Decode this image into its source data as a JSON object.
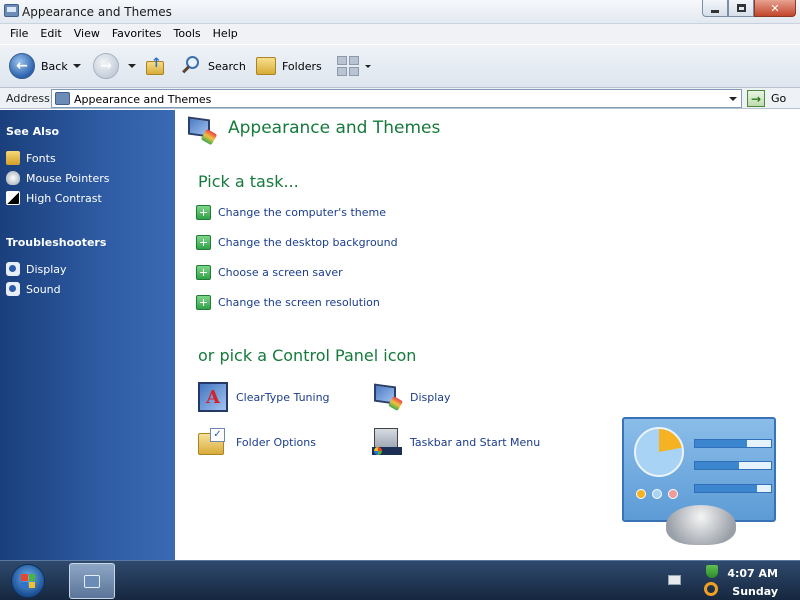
{
  "window": {
    "title": "Appearance and Themes"
  },
  "menubar": {
    "items": [
      "File",
      "Edit",
      "View",
      "Favorites",
      "Tools",
      "Help"
    ]
  },
  "toolbar": {
    "back_label": "Back",
    "search_label": "Search",
    "folders_label": "Folders"
  },
  "address": {
    "label": "Address",
    "value": "Appearance and Themes",
    "go_label": "Go"
  },
  "sidebar": {
    "see_also_heading": "See Also",
    "see_also": [
      {
        "label": "Fonts",
        "icon": "fonts-icon"
      },
      {
        "label": "Mouse Pointers",
        "icon": "mouse-pointer-icon"
      },
      {
        "label": "High Contrast",
        "icon": "high-contrast-icon"
      }
    ],
    "troubleshooters_heading": "Troubleshooters",
    "troubleshooters": [
      {
        "label": "Display",
        "icon": "troubleshooter-icon"
      },
      {
        "label": "Sound",
        "icon": "troubleshooter-icon"
      }
    ]
  },
  "main": {
    "title": "Appearance and Themes",
    "task_heading": "Pick a task...",
    "tasks": [
      "Change the computer's theme",
      "Change the desktop background",
      "Choose a screen saver",
      "Change the screen resolution"
    ],
    "icon_heading": "or pick a Control Panel icon",
    "icons": [
      {
        "label": "ClearType Tuning",
        "icon": "cleartype-icon"
      },
      {
        "label": "Display",
        "icon": "display-icon"
      },
      {
        "label": "Folder Options",
        "icon": "folder-options-icon"
      },
      {
        "label": "Taskbar and Start Menu",
        "icon": "taskbar-icon"
      }
    ]
  },
  "taskbar": {
    "time": "4:07 AM",
    "day": "Sunday"
  },
  "colors": {
    "heading_green": "#157a3b",
    "link_blue": "#1b3d8c",
    "sidebar_blue": "#2f5ca4"
  }
}
